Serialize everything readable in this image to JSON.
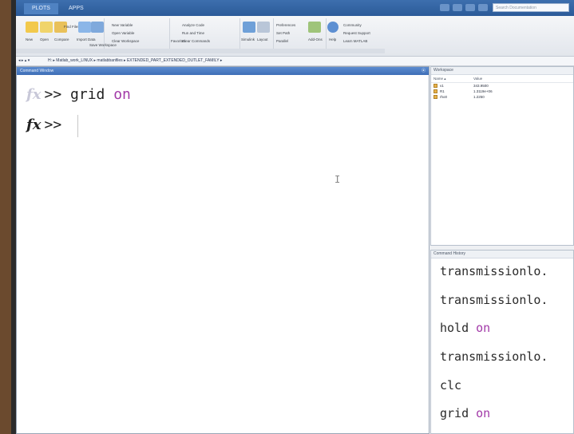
{
  "tabs": [
    "PLOTS",
    "APPS"
  ],
  "search": {
    "placeholder": "Search Documentation"
  },
  "ribbon": {
    "file": [
      "New",
      "Open",
      "Compare"
    ],
    "newscript": "New Script",
    "findfiles": "Find Files",
    "import": "Import Data",
    "save": "Save Workspace",
    "var": [
      "New Variable",
      "Open Variable",
      "Clear Workspace"
    ],
    "code": [
      "Analyze Code",
      "Run and Time",
      "Clear Commands"
    ],
    "favorites": "Favorites",
    "simulink": "Simulink",
    "layout": "Layout",
    "env": [
      "Preferences",
      "Set Path",
      "Parallel"
    ],
    "addons": "Add-Ons",
    "help": "Help",
    "resources": [
      "Community",
      "Request Support",
      "Learn MATLAB"
    ]
  },
  "address": {
    "path": "H: ▸ Matlab_work_LINUX ▸ matlabbanfiles ▸ EXTENDED_PART_EXTENDED_OUTLET_FAMILY ▸"
  },
  "command_window": {
    "title": "Command Window",
    "lines": [
      {
        "prompt": ">>",
        "cmd": "grid",
        "kw": "on"
      },
      {
        "prompt": ">>",
        "cmd": "",
        "kw": ""
      }
    ]
  },
  "workspace": {
    "title": "Workspace",
    "col_name": "Name ▴",
    "col_value": "Value",
    "vars": [
      {
        "name": "v1",
        "value": "343.9500"
      },
      {
        "name": "R1",
        "value": "1.3119e+06"
      },
      {
        "name": "rho0",
        "value": "1.2250"
      }
    ]
  },
  "history": {
    "title": "Command History",
    "items": [
      {
        "cmd": "transmissionlo.",
        "kw": ""
      },
      {
        "cmd": "transmissionlo.",
        "kw": ""
      },
      {
        "cmd": "hold ",
        "kw": "on"
      },
      {
        "cmd": "transmissionlo.",
        "kw": ""
      },
      {
        "cmd": "clc",
        "kw": ""
      },
      {
        "cmd": "grid ",
        "kw": "on"
      }
    ]
  },
  "colors": {
    "accent": "#3f6fb6",
    "keyword": "#a23aa8"
  }
}
